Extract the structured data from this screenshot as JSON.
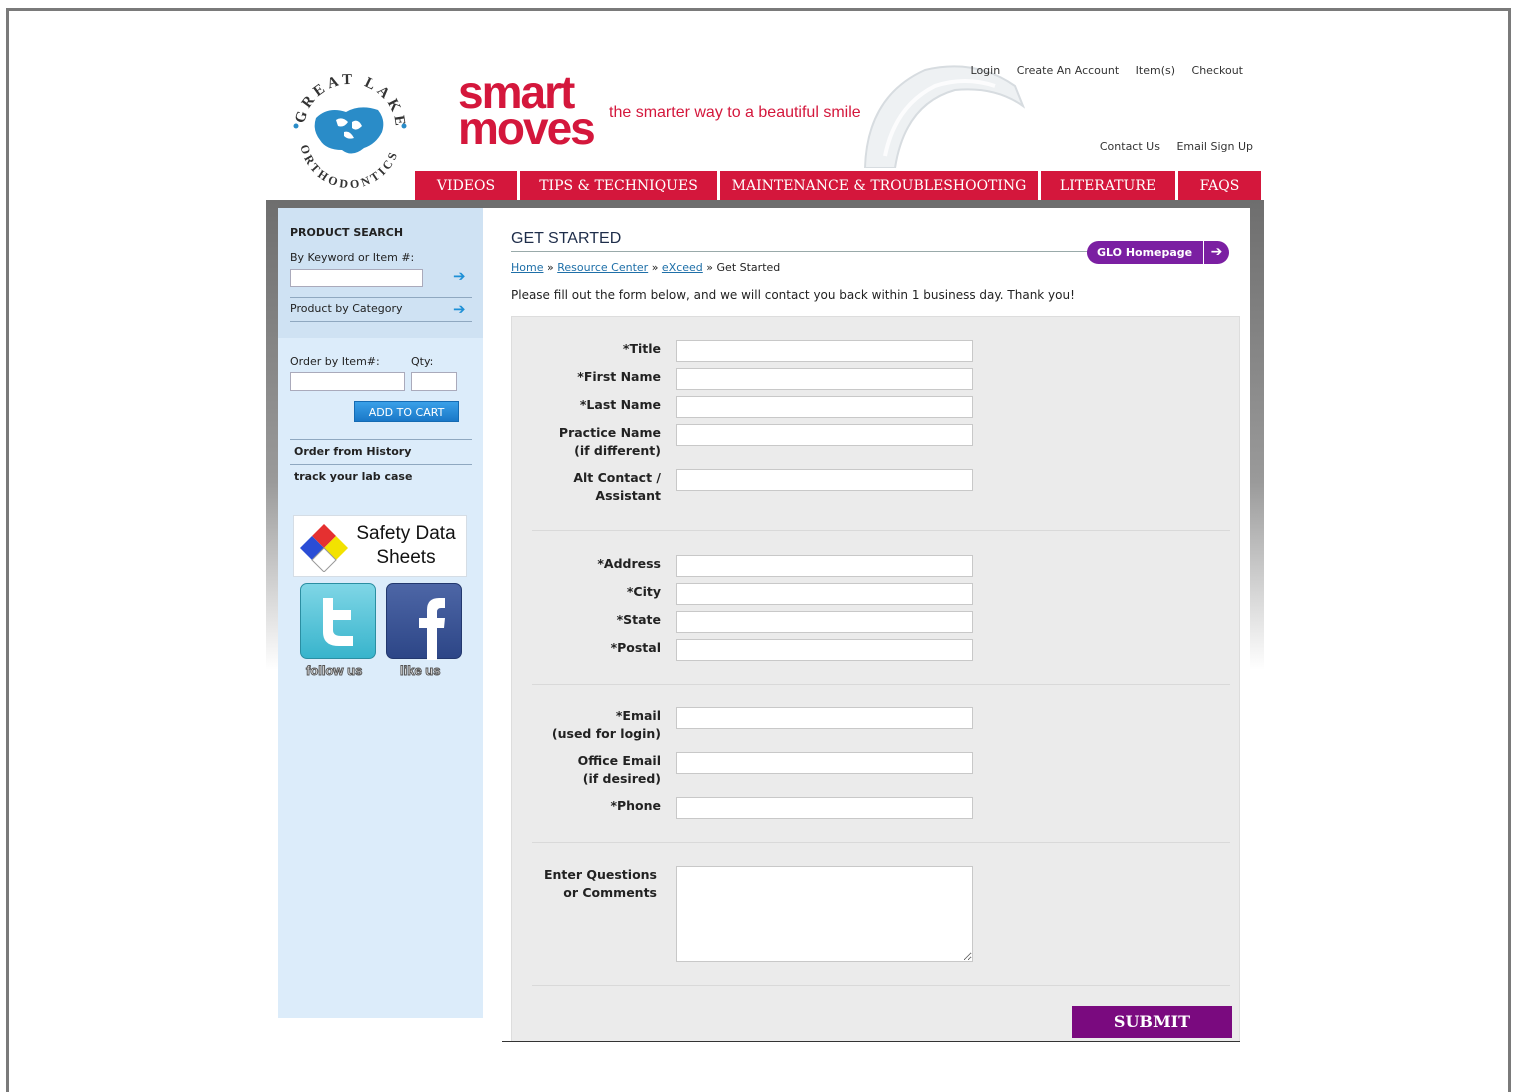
{
  "header": {
    "brand_line1": "smart",
    "brand_line2": "moves",
    "tagline": "the smarter way to a beautiful smile",
    "top_links": [
      "Login",
      "Create An Account",
      "Item(s)",
      "Checkout"
    ],
    "sub_links": [
      "Contact Us",
      "Email Sign Up"
    ],
    "logo_text": "GREAT LAKES ORTHODONTICS"
  },
  "nav": {
    "tabs": [
      "VIDEOS",
      "TIPS & TECHNIQUES",
      "MAINTENANCE & TROUBLESHOOTING",
      "LITERATURE",
      "FAQS"
    ]
  },
  "sidebar": {
    "search_title": "PRODUCT SEARCH",
    "search_label": "By Keyword or Item #:",
    "category_label": "Product by Category",
    "order_label": "Order by Item#:",
    "qty_label": "Qty:",
    "add_to_cart": "ADD TO CART",
    "order_history": "Order from History",
    "track_case": "track your lab case",
    "safety_data": "Safety Data Sheets",
    "follow_us": "follow us",
    "like_us": "like us"
  },
  "main": {
    "title": "GET STARTED",
    "glo_button": "GLO Homepage",
    "breadcrumb": {
      "home": "Home",
      "resource": "Resource Center",
      "exceed": "eXceed",
      "current": "Get Started",
      "sep": "»"
    },
    "intro": "Please fill out the form below, and we will contact you back within 1 business day. Thank you!",
    "form": {
      "title": "*Title",
      "first_name": "*First Name",
      "last_name": "*Last Name",
      "practice_name": "Practice Name",
      "practice_name_note": "(if different)",
      "alt_contact": "Alt Contact /",
      "alt_contact_note": "Assistant",
      "address": "*Address",
      "city": "*City",
      "state": "*State",
      "postal": "*Postal",
      "email": "*Email",
      "email_note": "(used for login)",
      "office_email": "Office Email",
      "office_email_note": "(if desired)",
      "phone": "*Phone",
      "questions": "Enter Questions",
      "questions_note": "or Comments",
      "submit": "SUBMIT"
    }
  },
  "colors": {
    "brand_red": "#d4173c",
    "submit_purple": "#7a0a7f",
    "glo_purple": "#7b1fa2",
    "sidebar_blue": "#dcecfa"
  }
}
